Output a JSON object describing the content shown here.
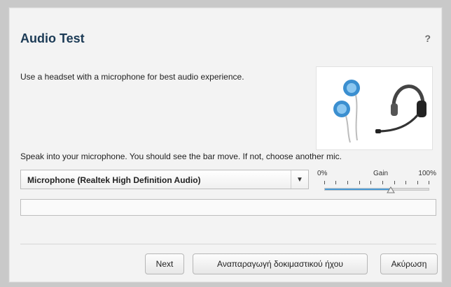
{
  "dialog": {
    "title": "Audio Test",
    "help_label": "?",
    "description": "Use a headset with a microphone for best audio experience.",
    "instruction": "Speak into your microphone. You should see the bar move. If not, choose another mic.",
    "image_alt": "headset-earphones-illustration"
  },
  "microphone": {
    "selected": "Microphone (Realtek High Definition Audio)"
  },
  "gain": {
    "min_label": "0%",
    "label": "Gain",
    "max_label": "100%",
    "level": 0.63
  },
  "meter": {
    "level": 0
  },
  "buttons": {
    "next": "Next",
    "play_test_sound": "Αναπαραγωγή δοκιμαστικού ήχου",
    "cancel": "Ακύρωση"
  },
  "colors": {
    "title": "#1b3a55",
    "accent": "#2f86c7"
  }
}
